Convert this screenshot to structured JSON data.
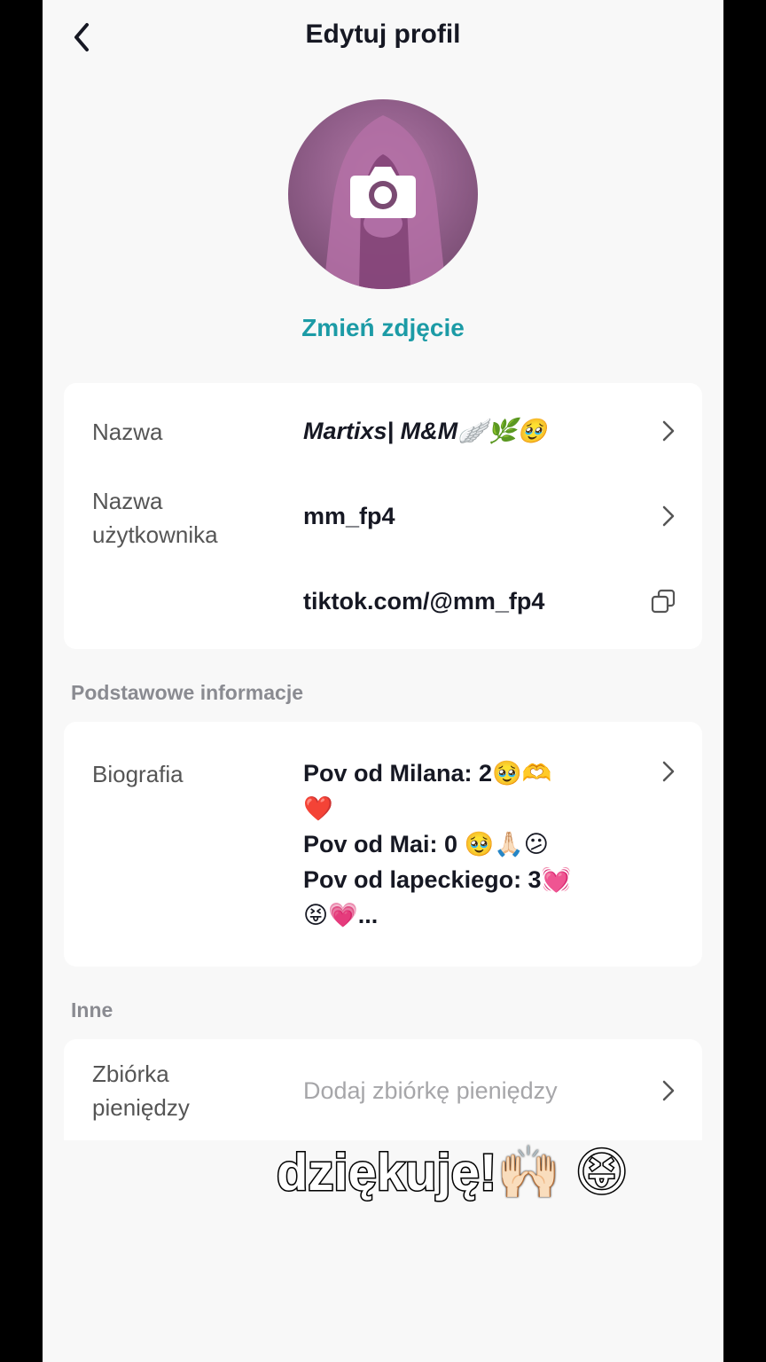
{
  "header": {
    "title": "Edytuj profil"
  },
  "photo": {
    "change_label": "Zmień zdjęcie"
  },
  "profile_rows": {
    "name": {
      "label": "Nazwa",
      "value": "Martixs| M&M🪽🌿🥹"
    },
    "username": {
      "label_line1": "Nazwa",
      "label_line2": "użytkownika",
      "value": "mm_fp4"
    },
    "link": {
      "value": "tiktok.com/@mm_fp4"
    }
  },
  "sections": {
    "basic": "Podstawowe informacje",
    "other": "Inne"
  },
  "bio": {
    "label": "Biografia",
    "lines": [
      "Pov od Milana: 2🥹🫶",
      "❤️",
      "Pov od Mai: 0 🥹🙏🏻😕",
      "Pov od lapeckiego: 3💓",
      "😝💗..."
    ]
  },
  "fundraiser": {
    "label_line1": "Zbiórka",
    "label_line2": "pieniędzy",
    "placeholder": "Dodaj zbiórkę pieniędzy"
  },
  "overlay_caption": "dziękuję!🙌🏻 😝",
  "colors": {
    "accent": "#1c9ba6",
    "background": "#f8f8f8",
    "card": "#ffffff"
  }
}
